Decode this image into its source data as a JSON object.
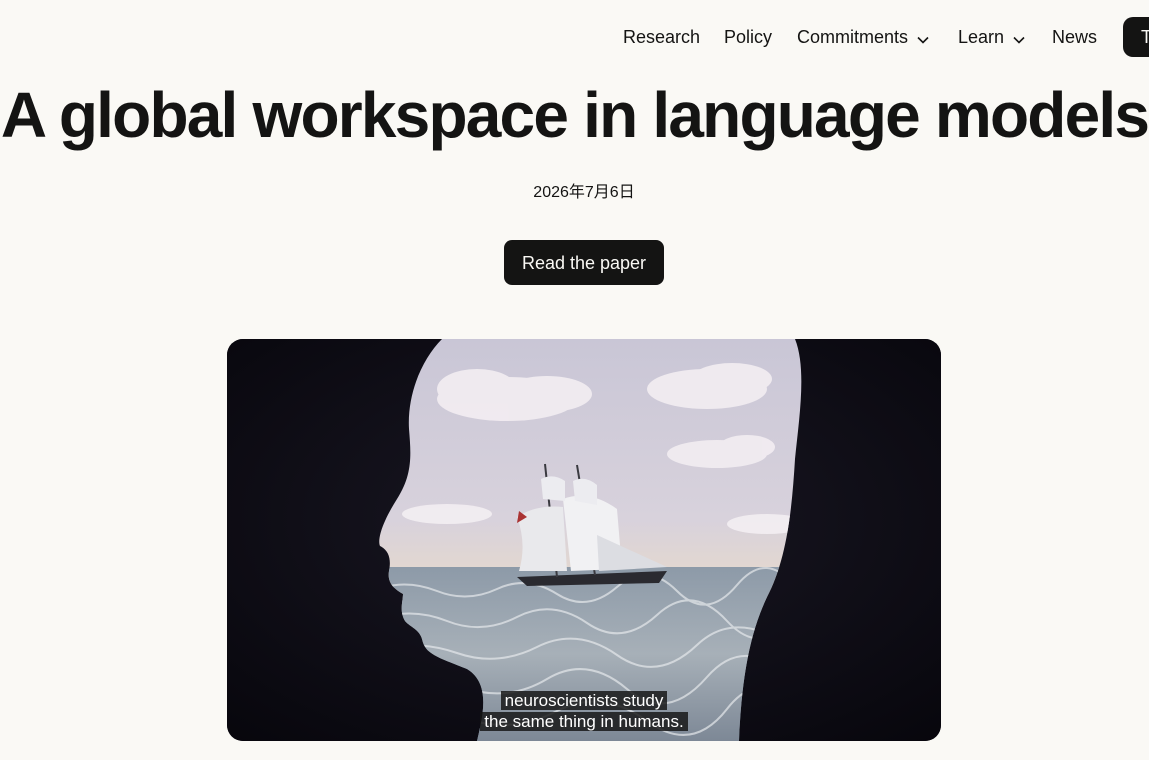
{
  "nav": {
    "items": [
      {
        "label": "Research"
      },
      {
        "label": "Policy"
      },
      {
        "label": "Commitments"
      },
      {
        "label": "Learn"
      },
      {
        "label": "News"
      }
    ],
    "cta_label": "T"
  },
  "page": {
    "title": "A global workspace in language models",
    "date": "2026年7月6日",
    "read_paper_label": "Read the paper"
  },
  "video": {
    "caption_line1": "neuroscientists study",
    "caption_line2": "the same thing in humans."
  },
  "colors": {
    "background": "#faf9f5",
    "text": "#141413",
    "button": "#141413",
    "video_bg": "#0c0a14"
  }
}
